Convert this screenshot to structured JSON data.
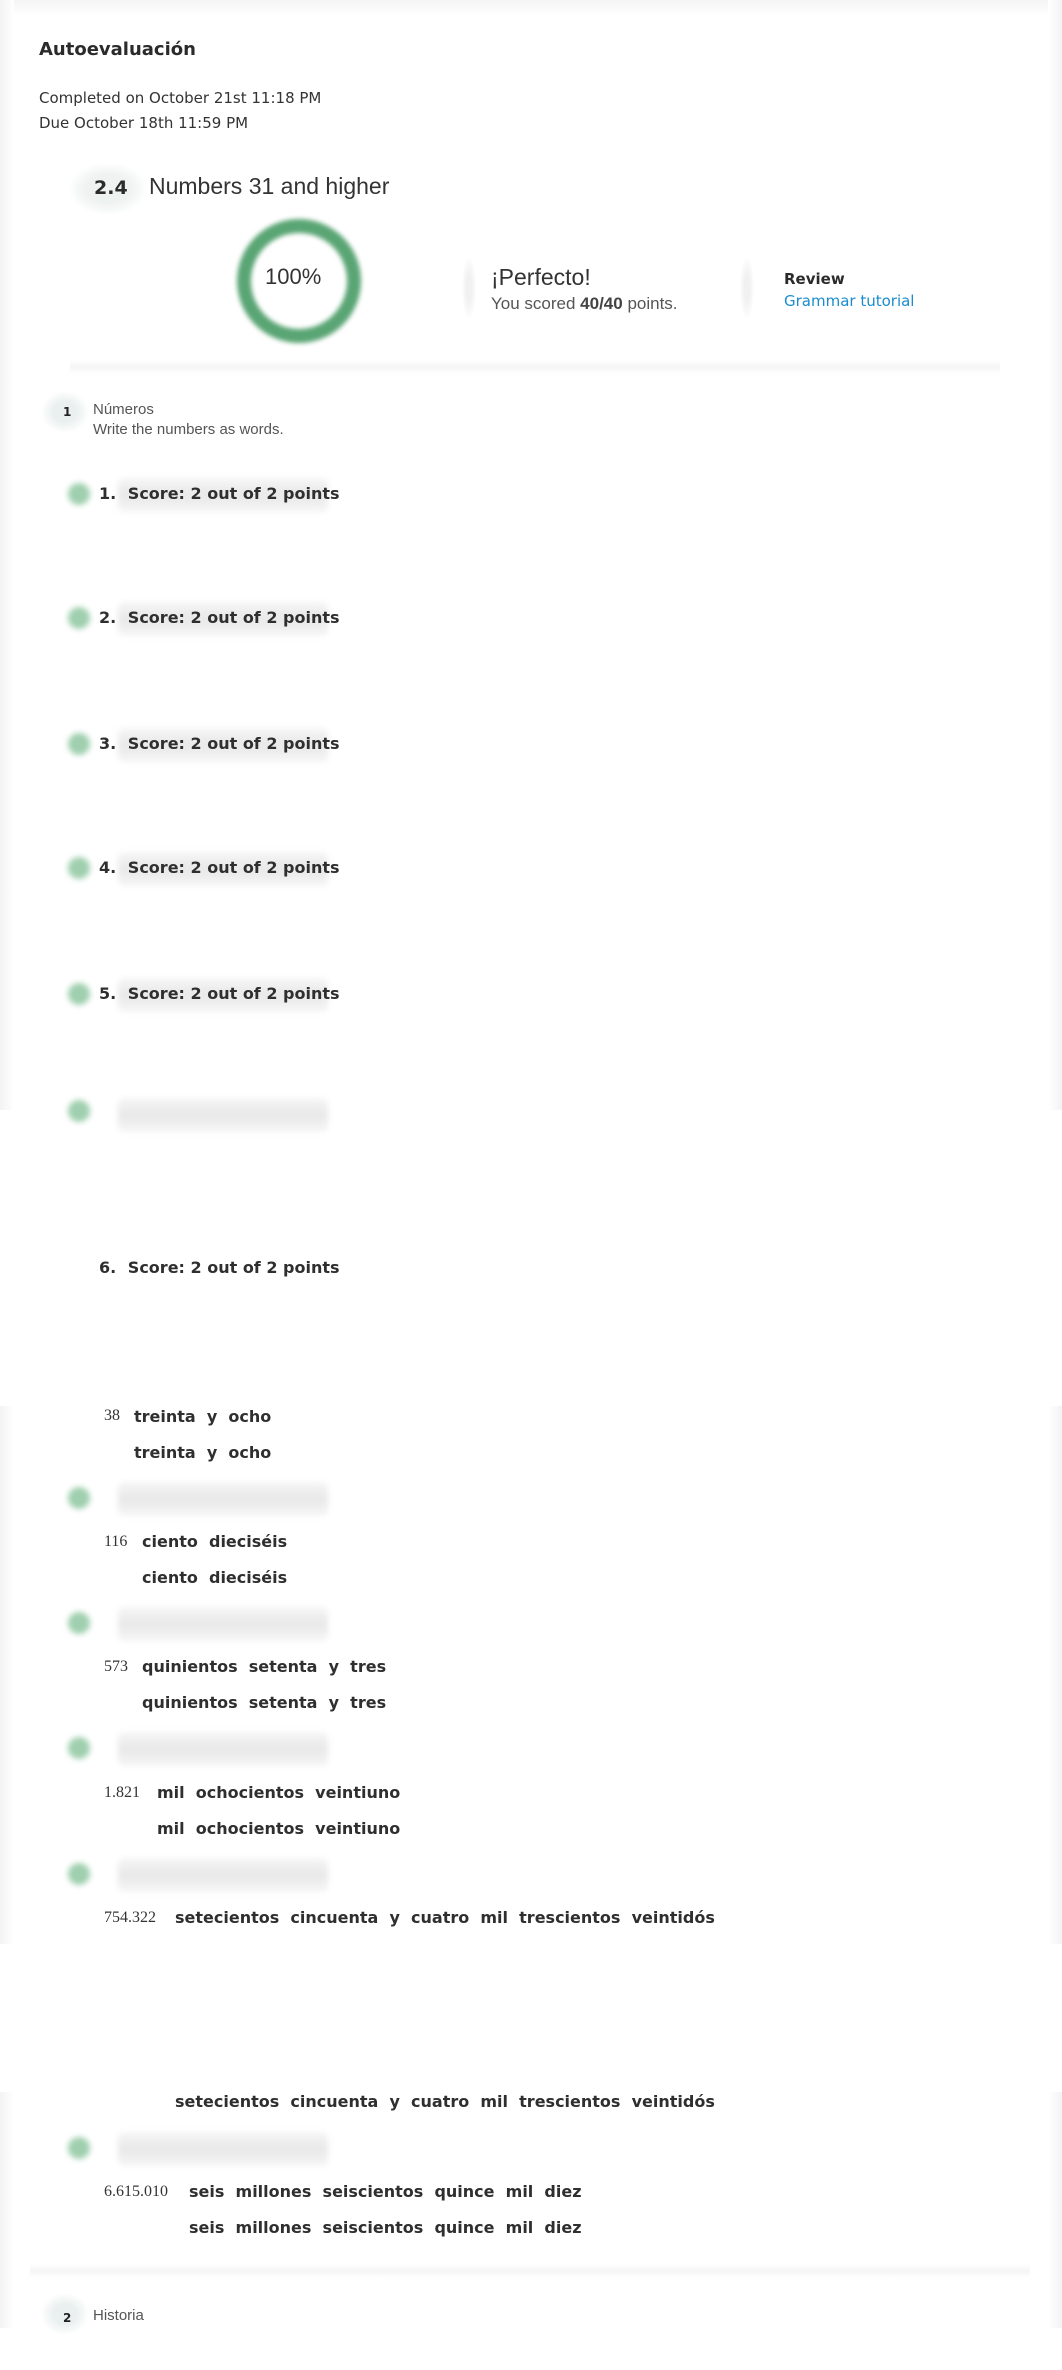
{
  "header": {
    "title": "Autoevaluación",
    "completed": "Completed on October 21st 11:18 PM",
    "due": "Due October 18th 11:59 PM"
  },
  "assignment": {
    "number": "2.4",
    "name": "Numbers 31 and higher"
  },
  "score_summary": {
    "percent_label": "100%",
    "percent_value": 100,
    "ring_color": "#5aa574",
    "headline": "¡Perfecto!",
    "scored_prefix": "You scored ",
    "scored_value": "40/40",
    "scored_suffix": " points.",
    "review_label": "Review",
    "review_link": "Grammar tutorial",
    "link_color": "#1a8ccf"
  },
  "section1": {
    "number": "1",
    "name": "Números",
    "instructions": "Write the numbers as words."
  },
  "questions": [
    {
      "num": "1.",
      "score": "Score: 2 out of 2 points"
    },
    {
      "num": "2.",
      "score": "Score: 2 out of 2 points"
    },
    {
      "num": "3.",
      "score": "Score: 2 out of 2 points"
    },
    {
      "num": "4.",
      "score": "Score: 2 out of 2 points"
    },
    {
      "num": "5.",
      "score": "Score: 2 out of 2 points"
    },
    {
      "num": "6.",
      "score": "Score: 2 out of 2 points"
    }
  ],
  "answers": [
    {
      "number": "38",
      "answer": "treinta  y  ocho",
      "correct": "treinta  y  ocho"
    },
    {
      "number": "116",
      "answer": "ciento  dieciséis",
      "correct": "ciento  dieciséis"
    },
    {
      "number": "573",
      "answer": "quinientos  setenta  y  tres",
      "correct": "quinientos  setenta  y  tres"
    },
    {
      "number": "1.821",
      "answer": "mil  ochocientos  veintiuno",
      "correct": "mil  ochocientos  veintiuno"
    },
    {
      "number": "754.322",
      "answer": "setecientos  cincuenta  y  cuatro  mil  trescientos  veintidós",
      "correct": "setecientos  cincuenta  y  cuatro  mil  trescientos  veintidós"
    },
    {
      "number": "6.615.010",
      "answer": "seis  millones  seiscientos  quince  mil  diez",
      "correct": "seis  millones  seiscientos  quince  mil  diez"
    }
  ],
  "section2": {
    "number": "2",
    "name": "Historia"
  }
}
